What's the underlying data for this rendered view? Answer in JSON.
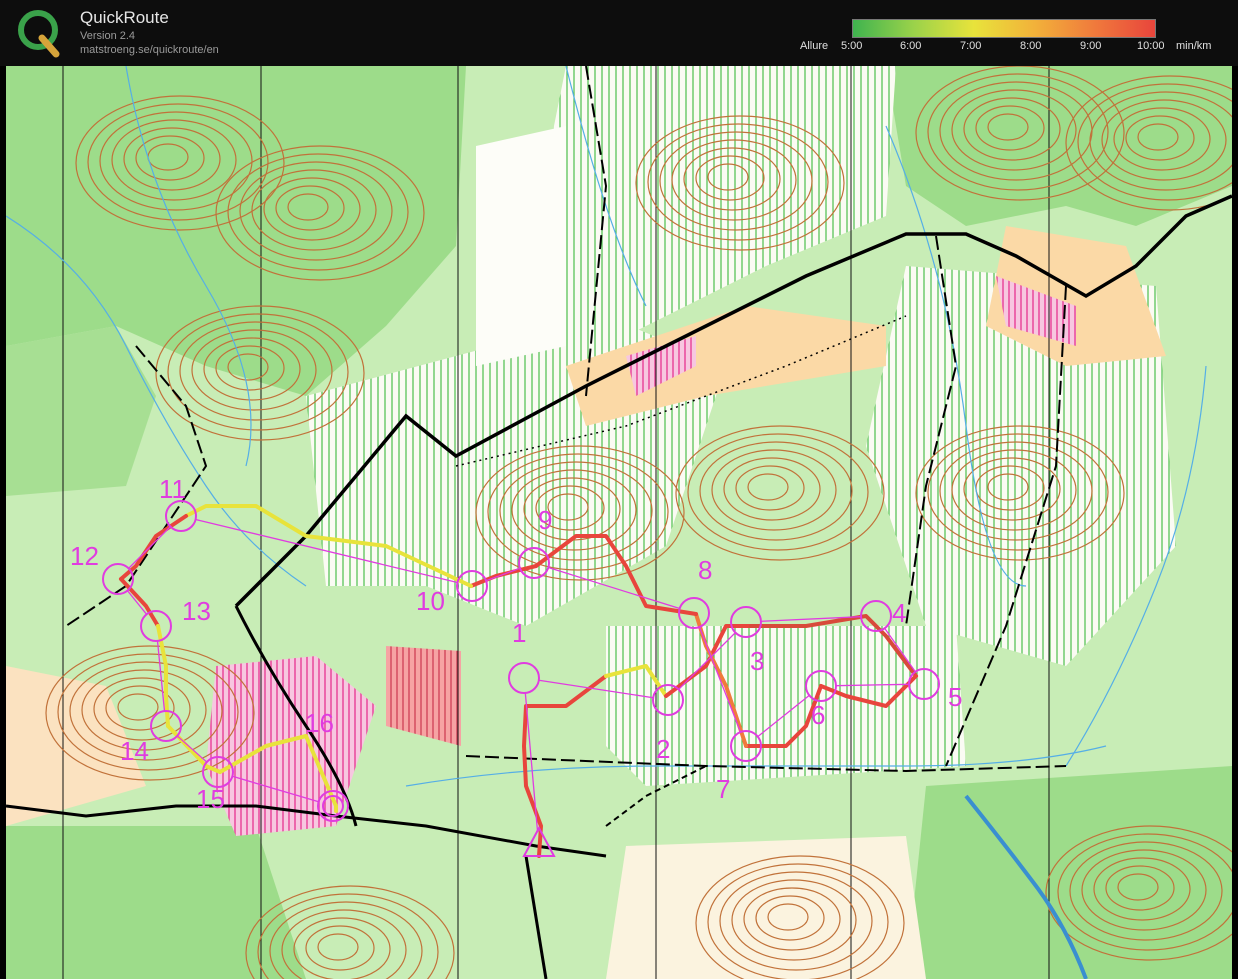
{
  "app": {
    "name": "QuickRoute",
    "version": "Version 2.4",
    "url": "matstroeng.se/quickroute/en"
  },
  "pace_legend": {
    "label": "Allure",
    "ticks": [
      "5:00",
      "6:00",
      "7:00",
      "8:00",
      "9:00",
      "10:00"
    ],
    "unit": "min/km",
    "colors": [
      "#3fb34f",
      "#9ad24a",
      "#e8e33b",
      "#f2b23a",
      "#f07a3c",
      "#e8453c"
    ]
  },
  "course": {
    "start_symbol": "triangle",
    "controls": [
      {
        "number": "1"
      },
      {
        "number": "2"
      },
      {
        "number": "3"
      },
      {
        "number": "4"
      },
      {
        "number": "5"
      },
      {
        "number": "6"
      },
      {
        "number": "7"
      },
      {
        "number": "8"
      },
      {
        "number": "9"
      },
      {
        "number": "10"
      },
      {
        "number": "11"
      },
      {
        "number": "12"
      },
      {
        "number": "13"
      },
      {
        "number": "14"
      },
      {
        "number": "15"
      },
      {
        "number": "16"
      }
    ],
    "course_color": "#e03ce0"
  },
  "map_colors": {
    "open": "#fdfdf8",
    "forest_green": "#9ddc8a",
    "light_green": "#c8edb6",
    "yellow": "#fbd9a6",
    "contour": "#c1723a",
    "water": "#55aee6",
    "marsh_pink": "#e8479a",
    "road": "#000000"
  }
}
